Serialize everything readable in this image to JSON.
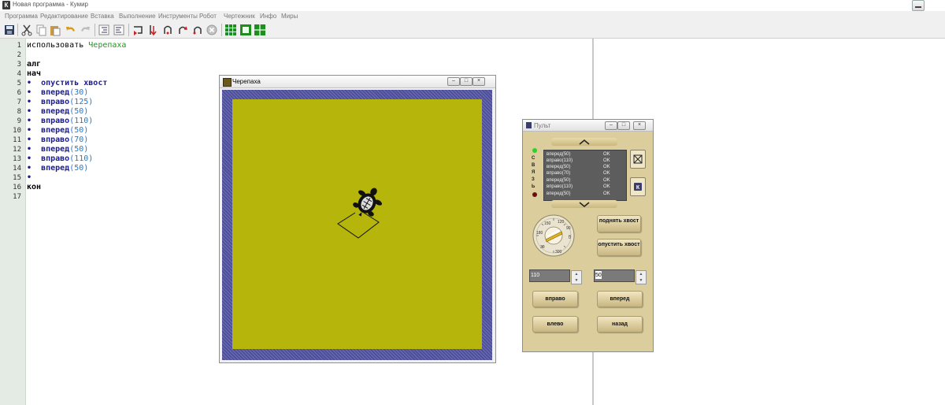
{
  "window": {
    "title": "Новая программа - Кумир",
    "icon_letter": "К"
  },
  "menu": [
    "Программа",
    "Редактирование",
    "Вставка",
    "Выполнение",
    "Инструменты",
    "Робот",
    "Чертежник",
    "Инфо",
    "Миры"
  ],
  "toolbar": {
    "icons": [
      "save-icon",
      "cut-icon",
      "copy-icon",
      "paste-icon",
      "undo-icon",
      "redo-icon",
      "indent-icon",
      "unindent-icon",
      "run-icon",
      "step-icon",
      "step-into-icon",
      "step-out-icon",
      "step-back-icon",
      "stop-icon",
      "grid-icon",
      "window-icon",
      "layout-icon"
    ]
  },
  "editor": {
    "line_numbers": [
      "1",
      "2",
      "3",
      "4",
      "5",
      "6",
      "7",
      "8",
      "9",
      "10",
      "11",
      "12",
      "13",
      "14",
      "15",
      "16",
      "17"
    ],
    "lines": {
      "l1_kw": "использовать",
      "l1_name": "Черепаха",
      "l3": "алг",
      "l4": "нач",
      "l5": "опустить хвост",
      "cmd_forward": "вперед",
      "cmd_right": "вправо",
      "v6": "30",
      "v7": "125",
      "v8": "50",
      "v9": "110",
      "v10": "50",
      "v11": "70",
      "v12": "50",
      "v13": "110",
      "v14": "50",
      "l16": "кон",
      "bullet": "•"
    }
  },
  "turtle_window": {
    "title": "Черепаха",
    "field_color": "#b5b50b",
    "border_color": "#4d4f9c"
  },
  "pult": {
    "title": "Пульт",
    "link_label": [
      "С",
      "В",
      "Я",
      "З",
      "Ь"
    ],
    "log": [
      {
        "cmd": "вперед(50)",
        "status": "OK"
      },
      {
        "cmd": "вправо(110)",
        "status": "OK"
      },
      {
        "cmd": "вперед(50)",
        "status": "OK"
      },
      {
        "cmd": "вправо(70)",
        "status": "OK"
      },
      {
        "cmd": "вперед(50)",
        "status": "OK"
      },
      {
        "cmd": "вправо(110)",
        "status": "OK"
      },
      {
        "cmd": "вперед(50)",
        "status": "OK"
      }
    ],
    "dial": {
      "marks": [
        "60",
        "90",
        "120",
        "150",
        "180",
        "300",
        "30",
        "0"
      ]
    },
    "buttons": {
      "raise_tail": "поднять хвост",
      "lower_tail": "опустить хвост",
      "right": "вправо",
      "forward": "вперед",
      "left": "влево",
      "back": "назад"
    },
    "angle_value": "110",
    "distance_value": "50",
    "side_k": "К"
  }
}
